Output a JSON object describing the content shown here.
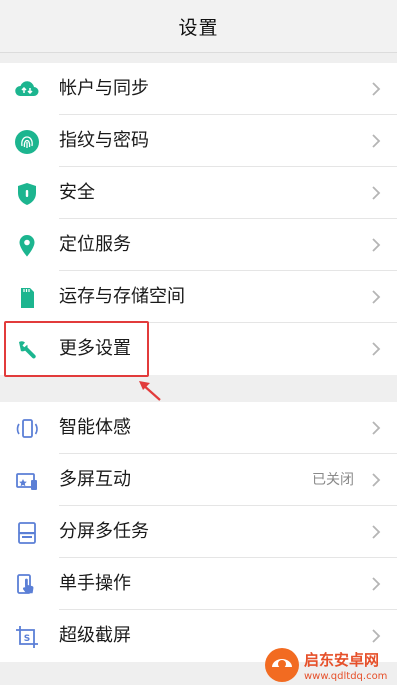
{
  "header": {
    "title": "设置"
  },
  "group1": [
    {
      "label": "帐户与同步",
      "icon": "cloud-sync-icon"
    },
    {
      "label": "指纹与密码",
      "icon": "fingerprint-icon"
    },
    {
      "label": "安全",
      "icon": "shield-icon"
    },
    {
      "label": "定位服务",
      "icon": "location-pin-icon"
    },
    {
      "label": "运存与存储空间",
      "icon": "sd-card-icon"
    },
    {
      "label": "更多设置",
      "icon": "wrench-icon"
    }
  ],
  "group2": [
    {
      "label": "智能体感",
      "icon": "motion-phone-icon"
    },
    {
      "label": "多屏互动",
      "icon": "multi-screen-icon",
      "value": "已关闭"
    },
    {
      "label": "分屏多任务",
      "icon": "split-screen-icon"
    },
    {
      "label": "单手操作",
      "icon": "one-hand-icon"
    },
    {
      "label": "超级截屏",
      "icon": "screenshot-icon"
    }
  ],
  "watermark": {
    "title": "启东安卓网",
    "url": "www.qdltdq.com"
  },
  "colors": {
    "green": "#1cb58f",
    "blue": "#5b7fd6",
    "highlight": "#e23b3b"
  }
}
